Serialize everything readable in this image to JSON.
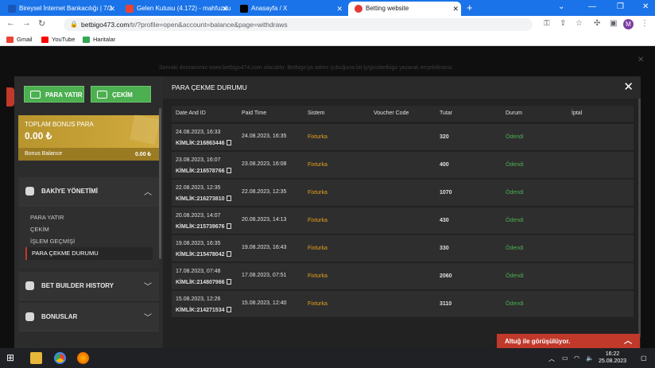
{
  "browser": {
    "tabs": [
      {
        "title": "Bireysel İnternet Bankacılığı | 7/2",
        "active": false,
        "fav_color": "#1a56b8"
      },
      {
        "title": "Gelen Kutusu (4.172) - mahfuzdu",
        "active": false,
        "fav_color": "#ea4335"
      },
      {
        "title": "Anasayfa / X",
        "active": false,
        "fav_color": "#000000"
      },
      {
        "title": "Betting website",
        "active": true,
        "fav_color": "#e53935"
      }
    ],
    "new_tab_glyph": "+",
    "url_host": "betbigo473.com",
    "url_path": "/tr/?profile=open&account=balance&page=withdraws",
    "profile_initial": "M",
    "bookmarks": [
      {
        "label": "Gmail",
        "color": "#ea4335"
      },
      {
        "label": "YouTube",
        "color": "#ff0000"
      },
      {
        "label": "Haritalar",
        "color": "#34a853"
      }
    ]
  },
  "notice": "Sonraki domainimiz www.betbigo474.com olacaktır. Betbigo'ya adres çubuğuna bit.ly/girisbetbigo yazarak erişebilirsiniz.",
  "sidebar": {
    "deposit_label": "PARA YATIR",
    "withdraw_label": "ÇEKİM",
    "bonus_title": "TOPLAM BONUS PARA",
    "bonus_amount": "0.00 ₺",
    "bonus_balance_label": "Bonus Balance",
    "bonus_balance_value": "0.00 ₺",
    "balance_mgmt_label": "BAKİYE YÖNETİMİ",
    "submenu": [
      "PARA YATIR",
      "ÇEKİM",
      "İŞLEM GEÇMİŞİ",
      "PARA ÇEKME DURUMU"
    ],
    "bet_builder_label": "BET BUILDER HISTORY",
    "bonuses_label": "BONUSLAR"
  },
  "modal": {
    "title": "PARA ÇEKME DURUMU",
    "columns": [
      "Date And ID",
      "Paid Time",
      "Sistem",
      "Voucher Code",
      "Tutar",
      "Durum",
      "İptal"
    ],
    "rows": [
      {
        "date": "24.08.2023, 16:33",
        "id": "KİMLİK:216863446",
        "paid": "24.08.2023, 16:35",
        "sistem": "Fixturka",
        "voucher": "",
        "tutar": "320",
        "durum": "Ödendi",
        "iptal": ""
      },
      {
        "date": "23.08.2023, 16:07",
        "id": "KİMLİK:216578766",
        "paid": "23.08.2023, 16:08",
        "sistem": "Fixturka",
        "voucher": "",
        "tutar": "400",
        "durum": "Ödendi",
        "iptal": ""
      },
      {
        "date": "22.08.2023, 12:35",
        "id": "KİMLİK:216273810",
        "paid": "22.08.2023, 12:35",
        "sistem": "Fixturka",
        "voucher": "",
        "tutar": "1070",
        "durum": "Ödendi",
        "iptal": ""
      },
      {
        "date": "20.08.2023, 14:07",
        "id": "KİMLİK:215739676",
        "paid": "20.08.2023, 14:13",
        "sistem": "Fixturka",
        "voucher": "",
        "tutar": "430",
        "durum": "Ödendi",
        "iptal": ""
      },
      {
        "date": "19.08.2023, 16:35",
        "id": "KİMLİK:215478042",
        "paid": "19.08.2023, 16:43",
        "sistem": "Fixturka",
        "voucher": "",
        "tutar": "330",
        "durum": "Ödendi",
        "iptal": ""
      },
      {
        "date": "17.08.2023, 07:48",
        "id": "KİMLİK:214807966",
        "paid": "17.08.2023, 07:51",
        "sistem": "Fixturka",
        "voucher": "",
        "tutar": "2060",
        "durum": "Ödendi",
        "iptal": ""
      },
      {
        "date": "15.08.2023, 12:26",
        "id": "KİMLİK:214271534",
        "paid": "15.08.2023, 12:40",
        "sistem": "Fixturka",
        "voucher": "",
        "tutar": "3110",
        "durum": "Ödendi",
        "iptal": ""
      }
    ]
  },
  "chat": {
    "label": "Altuğ ile görüşülüyor."
  },
  "taskbar": {
    "time": "16:22",
    "date": "25.08.2023"
  },
  "colors": {
    "accent_green": "#4caf50",
    "brand_red": "#c0392b",
    "bonus_gold": "#c9a236",
    "system_orange": "#e6a11d"
  }
}
